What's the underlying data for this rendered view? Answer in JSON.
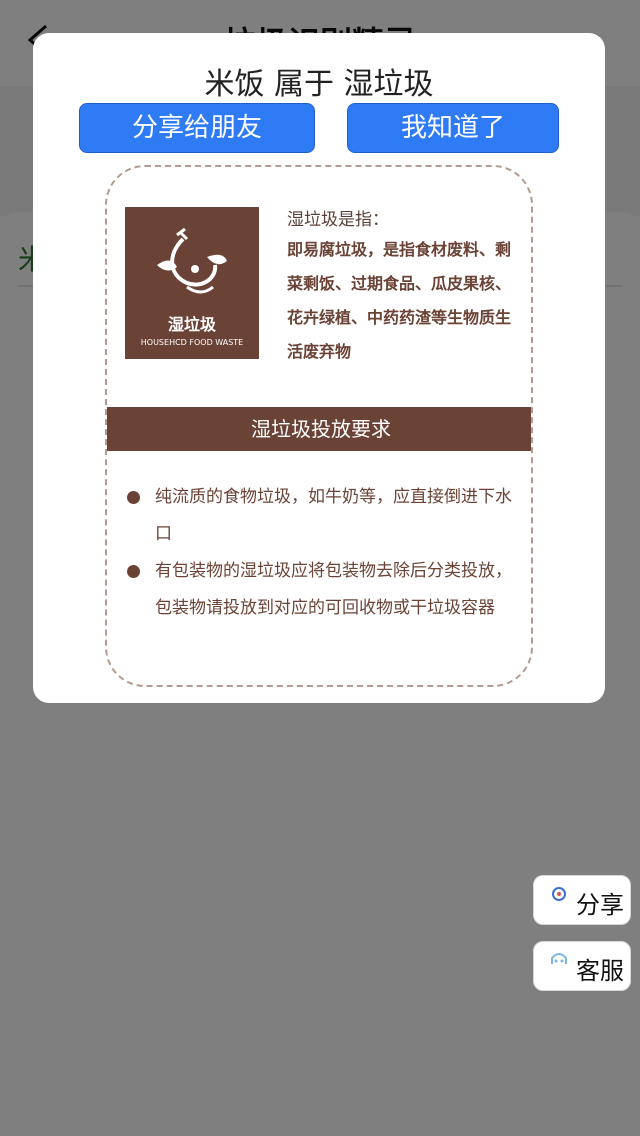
{
  "page": {
    "title": "垃圾识别精灵"
  },
  "card": {
    "text": "米"
  },
  "dialog": {
    "result_title": "米饭 属于 湿垃圾",
    "share_button": "分享给朋友",
    "ok_button": "我知道了"
  },
  "poster": {
    "logo_cn": "湿垃圾",
    "logo_en": "HOUSEHCD FOOD WASTE",
    "definition_heading": "湿垃圾是指：",
    "definition_body": "即易腐垃圾，是指食材废料、剩菜剩饭、过期食品、瓜皮果核、花卉绿植、中药药渣等生物质生活废弃物",
    "requirements_heading": "湿垃圾投放要求",
    "rules": [
      "纯流质的食物垃圾，如牛奶等，应直接倒进下水口",
      "有包装物的湿垃圾应将包装物去除后分类投放，包装物请投放到对应的可回收物或干垃圾容器"
    ]
  },
  "fabs": {
    "share": "分享",
    "service": "客服"
  },
  "colors": {
    "accent": "#2f7bf5",
    "brown": "#6b4336",
    "mask": "#808080"
  },
  "icons": {
    "back": "back-arrow-icon",
    "logo": "food-waste-icon",
    "share": "share-icon",
    "service": "customer-service-icon"
  }
}
